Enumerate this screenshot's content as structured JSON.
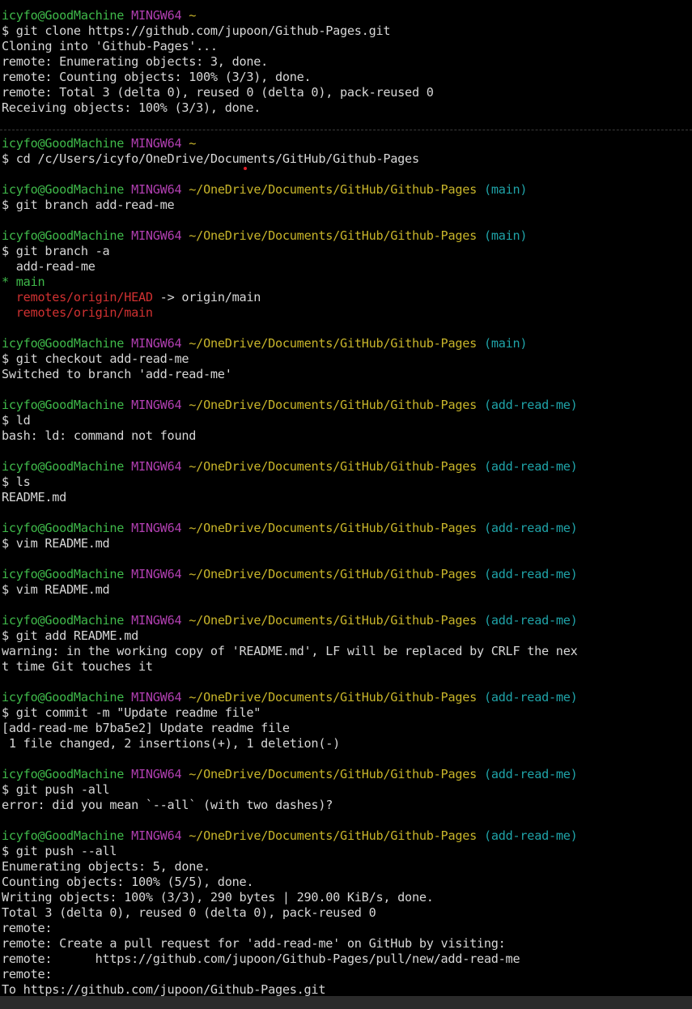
{
  "colors": {
    "background": "#000000",
    "user_host": "#3fb94a",
    "mingw": "#b13fb1",
    "path": "#c8b52a",
    "branch": "#1fa3a8",
    "remote_branch": "#d03131"
  },
  "prompt": {
    "user": "icyfo@GoodMachine",
    "env": "MINGW64",
    "home_path": "~",
    "repo_path": "~/OneDrive/Documents/GitHub/Github-Pages"
  },
  "block1": {
    "command": "$ git clone https://github.com/jupoon/Github-Pages.git",
    "output": [
      "Cloning into 'Github-Pages'...",
      "remote: Enumerating objects: 3, done.",
      "remote: Counting objects: 100% (3/3), done.",
      "remote: Total 3 (delta 0), reused 0 (delta 0), pack-reused 0",
      "Receiving objects: 100% (3/3), done."
    ]
  },
  "block2": {
    "cmd_cd": "$ cd /c/Users/icyfo/OneDrive/Documents/GitHub/Github-Pages",
    "branch_main": "(main)",
    "branch_feature": "(add-read-me)",
    "cmd_branch_add": "$ git branch add-read-me",
    "cmd_branch_a": "$ git branch -a",
    "branch_list": {
      "add_read_me": "  add-read-me",
      "main": "* main",
      "remote_head": "  remotes/origin/HEAD",
      "remote_head_target": " -> origin/main",
      "remote_main": "  remotes/origin/main"
    },
    "cmd_checkout": "$ git checkout add-read-me",
    "out_checkout": "Switched to branch 'add-read-me'",
    "cmd_ld": "$ ld",
    "out_ld": "bash: ld: command not found",
    "cmd_ls": "$ ls",
    "out_ls": "README.md",
    "cmd_vim": "$ vim README.md",
    "cmd_add": "$ git add README.md",
    "out_add_1": "warning: in the working copy of 'README.md', LF will be replaced by CRLF the nex",
    "out_add_2": "t time Git touches it",
    "cmd_commit": "$ git commit -m \"Update readme file\"",
    "out_commit_1": "[add-read-me b7ba5e2] Update readme file",
    "out_commit_2": " 1 file changed, 2 insertions(+), 1 deletion(-)",
    "cmd_push_bad": "$ git push -all",
    "out_push_bad": "error: did you mean `--all` (with two dashes)?",
    "cmd_push": "$ git push --all",
    "out_push": [
      "Enumerating objects: 5, done.",
      "Counting objects: 100% (5/5), done.",
      "Writing objects: 100% (3/3), 290 bytes | 290.00 KiB/s, done.",
      "Total 3 (delta 0), reused 0 (delta 0), pack-reused 0",
      "remote:",
      "remote: Create a pull request for 'add-read-me' on GitHub by visiting:",
      "remote:      https://github.com/jupoon/Github-Pages/pull/new/add-read-me",
      "remote:",
      "To https://github.com/jupoon/Github-Pages.git"
    ]
  }
}
